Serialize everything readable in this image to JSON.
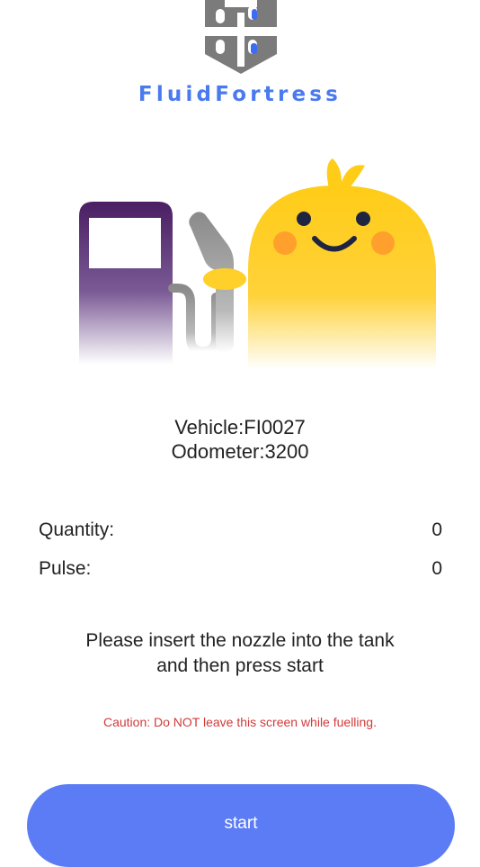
{
  "brand": {
    "name": "FluidFortress",
    "accent": "#4a7aee"
  },
  "vehicle": {
    "line": "Vehicle:FI0027",
    "odometer_line": "Odometer:3200"
  },
  "readings": [
    {
      "label": "Quantity:",
      "value": "0"
    },
    {
      "label": "Pulse:",
      "value": "0"
    }
  ],
  "instructions": {
    "line1": "Please insert the nozzle into the tank",
    "line2": "and then press start"
  },
  "caution": {
    "text": "Caution: Do NOT leave this screen while fuelling.",
    "color": "#d23a3a"
  },
  "start_button": {
    "label": "start",
    "color": "#5b7cf5"
  },
  "icons": {
    "logo": "fortress-logo-icon",
    "hero": "fuel-pump-mascot-illustration"
  }
}
